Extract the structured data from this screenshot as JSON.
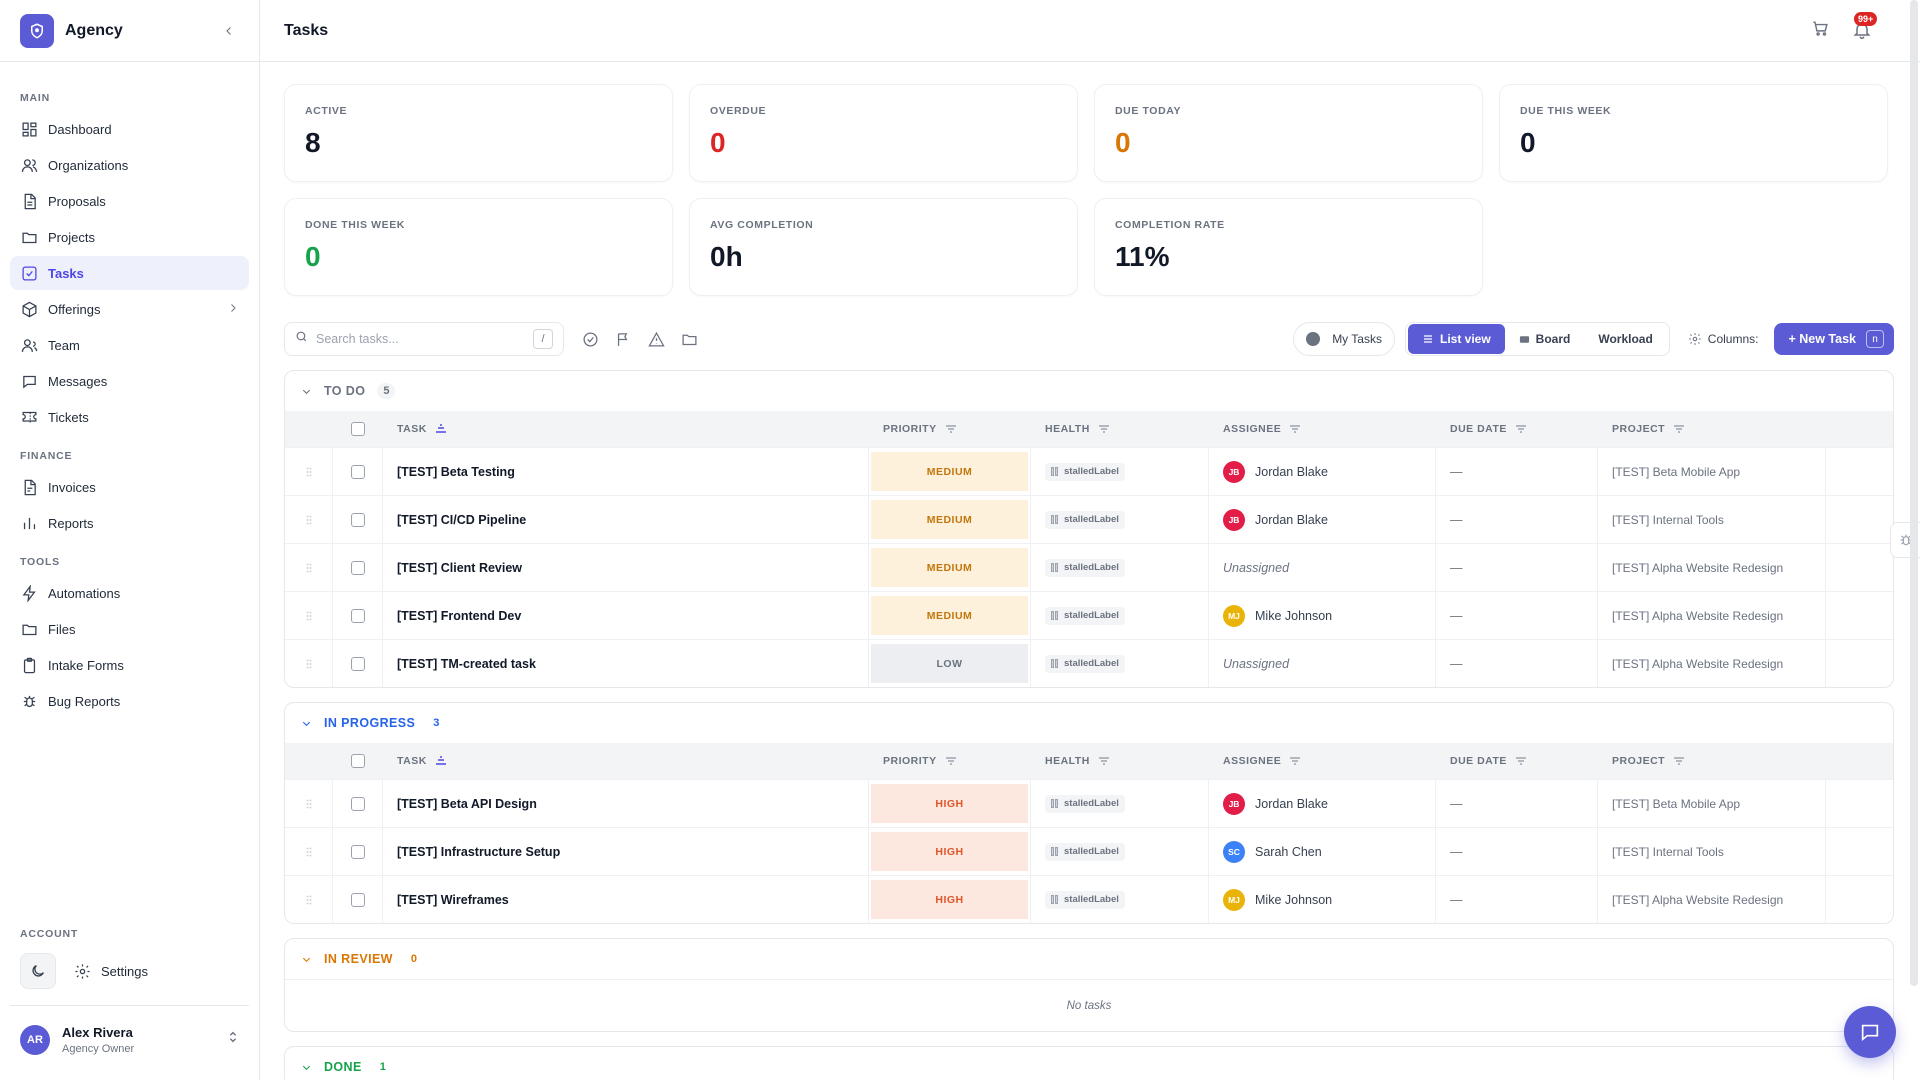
{
  "brand": {
    "name": "Agency"
  },
  "sidebar": {
    "sections": [
      {
        "label": "MAIN",
        "items": [
          {
            "label": "Dashboard",
            "icon": "dashboard-icon"
          },
          {
            "label": "Organizations",
            "icon": "users-icon"
          },
          {
            "label": "Proposals",
            "icon": "file-icon"
          },
          {
            "label": "Projects",
            "icon": "folder-icon"
          },
          {
            "label": "Tasks",
            "icon": "check-square-icon",
            "active": true
          },
          {
            "label": "Offerings",
            "icon": "box-icon",
            "has_children": true
          },
          {
            "label": "Team",
            "icon": "user-icon"
          },
          {
            "label": "Messages",
            "icon": "message-icon"
          },
          {
            "label": "Tickets",
            "icon": "ticket-icon"
          }
        ]
      },
      {
        "label": "FINANCE",
        "items": [
          {
            "label": "Invoices",
            "icon": "invoice-icon"
          },
          {
            "label": "Reports",
            "icon": "bar-chart-icon"
          }
        ]
      },
      {
        "label": "TOOLS",
        "items": [
          {
            "label": "Automations",
            "icon": "zap-icon"
          },
          {
            "label": "Files",
            "icon": "folder-icon"
          },
          {
            "label": "Intake Forms",
            "icon": "clipboard-icon"
          },
          {
            "label": "Bug Reports",
            "icon": "bug-icon"
          }
        ]
      }
    ],
    "account_label": "ACCOUNT",
    "settings_label": "Settings",
    "user": {
      "initials": "AR",
      "name": "Alex Rivera",
      "role": "Agency Owner"
    }
  },
  "header": {
    "title": "Tasks",
    "notifications_badge": "99+"
  },
  "stats": [
    {
      "label": "ACTIVE",
      "value": "8",
      "color": "#111827"
    },
    {
      "label": "OVERDUE",
      "value": "0",
      "color": "#dc2626"
    },
    {
      "label": "DUE TODAY",
      "value": "0",
      "color": "#d97706"
    },
    {
      "label": "DUE THIS WEEK",
      "value": "0",
      "color": "#111827"
    },
    {
      "label": "DONE THIS WEEK",
      "value": "0",
      "color": "#16a34a"
    },
    {
      "label": "AVG COMPLETION",
      "value": "0h",
      "color": "#111827"
    },
    {
      "label": "COMPLETION RATE",
      "value": "11%",
      "color": "#111827"
    }
  ],
  "toolbar": {
    "search_placeholder": "Search tasks...",
    "search_shortcut": "/",
    "my_tasks_label": "My Tasks",
    "views": [
      {
        "label": "List view",
        "active": true
      },
      {
        "label": "Board",
        "active": false
      },
      {
        "label": "Workload",
        "active": false
      }
    ],
    "columns_label": "Columns:",
    "new_task_label": "+ New Task",
    "new_task_shortcut": "n"
  },
  "table_headers": {
    "task": "TASK",
    "priority": "PRIORITY",
    "health": "HEALTH",
    "assignee": "ASSIGNEE",
    "due_date": "DUE DATE",
    "project": "PROJECT"
  },
  "groups": [
    {
      "title": "TO DO",
      "count": "5",
      "color": "#6b7280",
      "count_bg": "#f3f4f6",
      "count_color": "#6b7280",
      "tasks": [
        {
          "title": "[TEST] Beta Testing",
          "priority": "MEDIUM",
          "health": "stalledLabel",
          "assignee": "Jordan Blake",
          "initials": "JB",
          "avatar_color": "#e11d48",
          "due": "—",
          "project": "[TEST] Beta Mobile App"
        },
        {
          "title": "[TEST] CI/CD Pipeline",
          "priority": "MEDIUM",
          "health": "stalledLabel",
          "assignee": "Jordan Blake",
          "initials": "JB",
          "avatar_color": "#e11d48",
          "due": "—",
          "project": "[TEST] Internal Tools"
        },
        {
          "title": "[TEST] Client Review",
          "priority": "MEDIUM",
          "health": "stalledLabel",
          "assignee": "Unassigned",
          "initials": "",
          "avatar_color": "",
          "due": "—",
          "project": "[TEST] Alpha Website Redesign"
        },
        {
          "title": "[TEST] Frontend Dev",
          "priority": "MEDIUM",
          "health": "stalledLabel",
          "assignee": "Mike Johnson",
          "initials": "MJ",
          "avatar_color": "#eab308",
          "due": "—",
          "project": "[TEST] Alpha Website Redesign"
        },
        {
          "title": "[TEST] TM-created task",
          "priority": "LOW",
          "health": "stalledLabel",
          "assignee": "Unassigned",
          "initials": "",
          "avatar_color": "",
          "due": "—",
          "project": "[TEST] Alpha Website Redesign"
        }
      ]
    },
    {
      "title": "IN PROGRESS",
      "count": "3",
      "color": "#2563eb",
      "count_bg": "transparent",
      "count_color": "#2563eb",
      "tasks": [
        {
          "title": "[TEST] Beta API Design",
          "priority": "HIGH",
          "health": "stalledLabel",
          "assignee": "Jordan Blake",
          "initials": "JB",
          "avatar_color": "#e11d48",
          "due": "—",
          "project": "[TEST] Beta Mobile App"
        },
        {
          "title": "[TEST] Infrastructure Setup",
          "priority": "HIGH",
          "health": "stalledLabel",
          "assignee": "Sarah Chen",
          "initials": "SC",
          "avatar_color": "#3b82f6",
          "due": "—",
          "project": "[TEST] Internal Tools"
        },
        {
          "title": "[TEST] Wireframes",
          "priority": "HIGH",
          "health": "stalledLabel",
          "assignee": "Mike Johnson",
          "initials": "MJ",
          "avatar_color": "#eab308",
          "due": "—",
          "project": "[TEST] Alpha Website Redesign"
        }
      ]
    },
    {
      "title": "IN REVIEW",
      "count": "0",
      "color": "#d97706",
      "count_bg": "transparent",
      "count_color": "#d97706",
      "tasks": [],
      "empty_text": "No tasks"
    },
    {
      "title": "DONE",
      "count": "1",
      "color": "#16a34a",
      "count_bg": "transparent",
      "count_color": "#16a34a",
      "tasks": [],
      "collapsed_rows": true
    }
  ]
}
